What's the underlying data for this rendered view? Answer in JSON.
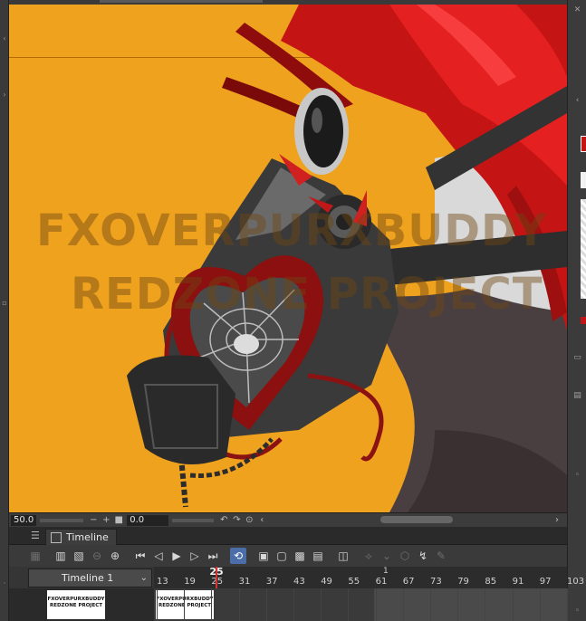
{
  "canvas": {
    "background": "#efa21e",
    "watermark_line1": "FXOVERPURXBUDDY",
    "watermark_line2": "REDZONE PROJECT"
  },
  "canvas_status": {
    "zoom": "50.0",
    "rotation": "0.0"
  },
  "timeline": {
    "tab_label": "Timeline",
    "selector_value": "Timeline 1",
    "current_frame": "25",
    "end_marker": "1",
    "tick_labels": [
      "13",
      "19",
      "25",
      "31",
      "37",
      "43",
      "49",
      "55",
      "61",
      "67",
      "73",
      "79",
      "85",
      "91",
      "97",
      "103"
    ],
    "cel_thumb_line1": "FXOVERPURXBUDDY",
    "cel_thumb_line2": "REDZONE PROJECT"
  },
  "colors": {
    "accent": "#4c6ea8",
    "playhead": "#d23232",
    "canvas_bg": "#efa21e"
  }
}
